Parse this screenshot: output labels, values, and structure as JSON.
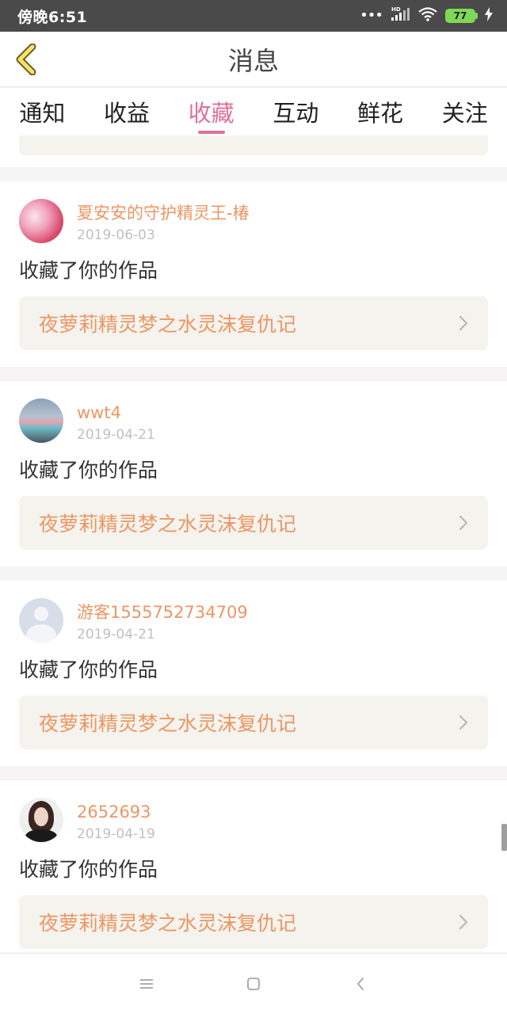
{
  "status_bar": {
    "time": "傍晚6:51",
    "battery": "77",
    "network": "HD"
  },
  "header": {
    "title": "消息"
  },
  "tabs": [
    {
      "label": "通知",
      "active": false
    },
    {
      "label": "收益",
      "active": false
    },
    {
      "label": "收藏",
      "active": true
    },
    {
      "label": "互动",
      "active": false
    },
    {
      "label": "鲜花",
      "active": false
    },
    {
      "label": "关注",
      "active": false
    }
  ],
  "messages": [
    {
      "username": "夏安安的守护精灵王-椿",
      "date": "2019-06-03",
      "action": "收藏了你的作品",
      "work_title": "夜萝莉精灵梦之水灵沫复仇记"
    },
    {
      "username": "wwt4",
      "date": "2019-04-21",
      "action": "收藏了你的作品",
      "work_title": "夜萝莉精灵梦之水灵沫复仇记"
    },
    {
      "username": "游客1555752734709",
      "date": "2019-04-21",
      "action": "收藏了你的作品",
      "work_title": "夜萝莉精灵梦之水灵沫复仇记"
    },
    {
      "username": "2652693",
      "date": "2019-04-19",
      "action": "收藏了你的作品",
      "work_title": "夜萝莉精灵梦之水灵沫复仇记"
    }
  ],
  "colors": {
    "accent": "#e0709a",
    "link": "#ec9664",
    "status_bar": "#4a4a4a",
    "battery": "#7ed957"
  },
  "icons": {
    "back": "chevron-left-icon",
    "menu": "menu-icon",
    "home": "square-icon",
    "nav_back": "chevron-left-icon"
  }
}
